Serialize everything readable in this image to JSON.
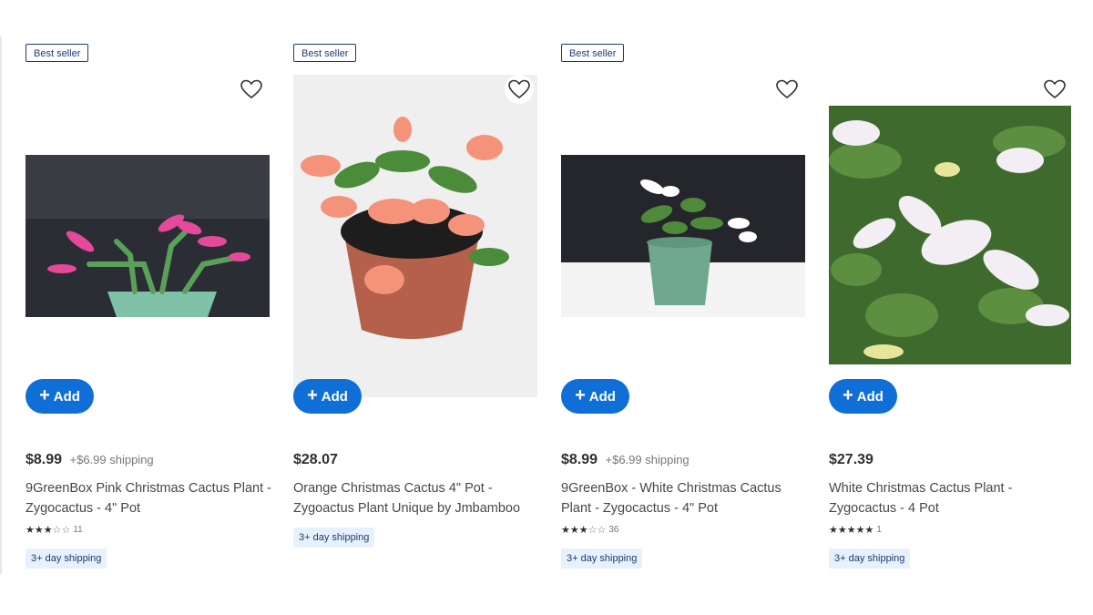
{
  "products": [
    {
      "badge": "Best seller",
      "price": "$8.99",
      "shipping": "+$6.99 shipping",
      "title": "9GreenBox Pink Christmas Cactus Plant - Zygocactus - 4\" Pot",
      "stars": 3,
      "rating_count": "11",
      "tag": "3+ day shipping",
      "add_label": "Add",
      "colors": {
        "flower": "#e6489a",
        "bg": "#2a2c33"
      }
    },
    {
      "badge": "Best seller",
      "price": "$28.07",
      "shipping": "",
      "title": "Orange Christmas Cactus 4\" Pot - Zygoactus Plant Unique by Jmbamboo",
      "stars": 0,
      "rating_count": "",
      "tag": "3+ day shipping",
      "add_label": "Add",
      "colors": {
        "flower": "#f4937a",
        "bg": "#f1f1f1"
      }
    },
    {
      "badge": "Best seller",
      "price": "$8.99",
      "shipping": "+$6.99 shipping",
      "title": "9GreenBox - White Christmas Cactus Plant - Zygocactus - 4\" Pot",
      "stars": 3,
      "rating_count": "36",
      "tag": "3+ day shipping",
      "add_label": "Add",
      "colors": {
        "flower": "#ffffff",
        "bg": "#25262b"
      }
    },
    {
      "badge": "",
      "price": "$27.39",
      "shipping": "",
      "title": "White Christmas Cactus Plant - Zygocactus - 4 Pot",
      "stars": 5,
      "rating_count": "1",
      "tag": "3+ day shipping",
      "add_label": "Add",
      "colors": {
        "flower": "#f3eef3",
        "bg": "#3f6a2e"
      }
    }
  ],
  "icons": {
    "heart": "heart-outline-icon",
    "plus": "plus-icon",
    "star": "star-icon"
  },
  "colors": {
    "accent": "#0f6fd6",
    "badge_border": "#1e3a73",
    "tag_bg": "#e6f1fc"
  }
}
